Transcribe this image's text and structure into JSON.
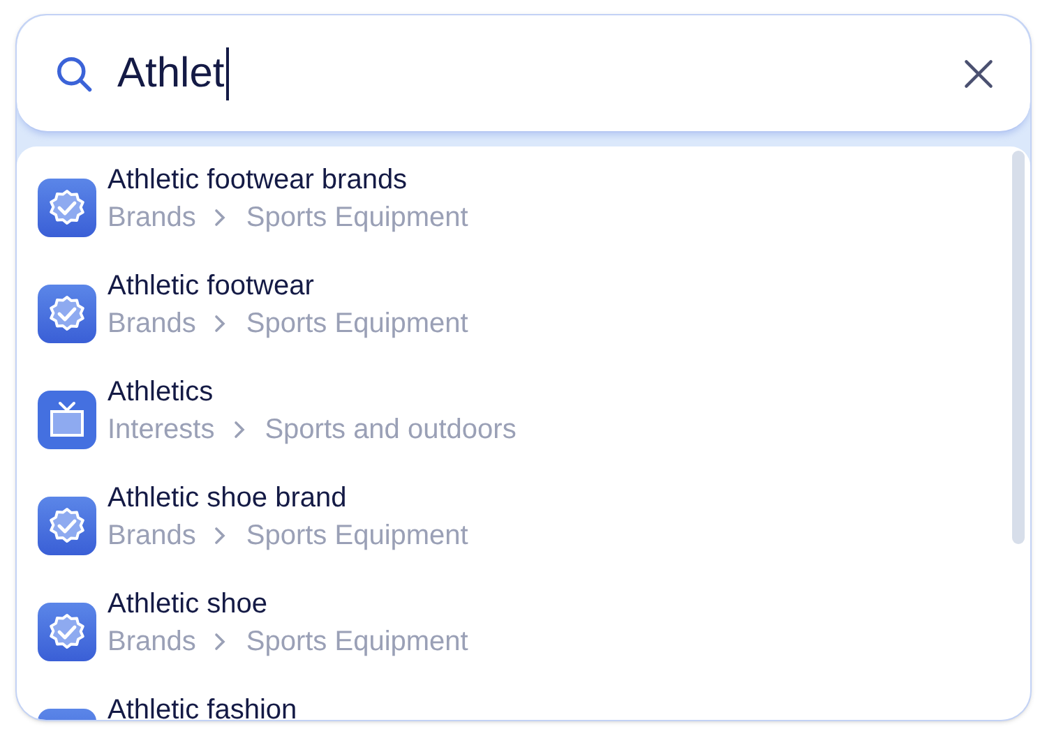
{
  "search": {
    "value": "Athlet"
  },
  "results": [
    {
      "kind": "brand",
      "title": "Athletic footwear brands",
      "path": [
        "Brands",
        "Sports Equipment"
      ]
    },
    {
      "kind": "brand",
      "title": "Athletic footwear",
      "path": [
        "Brands",
        "Sports Equipment"
      ]
    },
    {
      "kind": "interest",
      "title": "Athletics",
      "path": [
        "Interests",
        "Sports and outdoors"
      ]
    },
    {
      "kind": "brand",
      "title": "Athletic shoe brand",
      "path": [
        "Brands",
        "Sports Equipment"
      ]
    },
    {
      "kind": "brand",
      "title": "Athletic shoe",
      "path": [
        "Brands",
        "Sports Equipment"
      ]
    },
    {
      "kind": "brand",
      "title": "Athletic fashion"
    }
  ]
}
